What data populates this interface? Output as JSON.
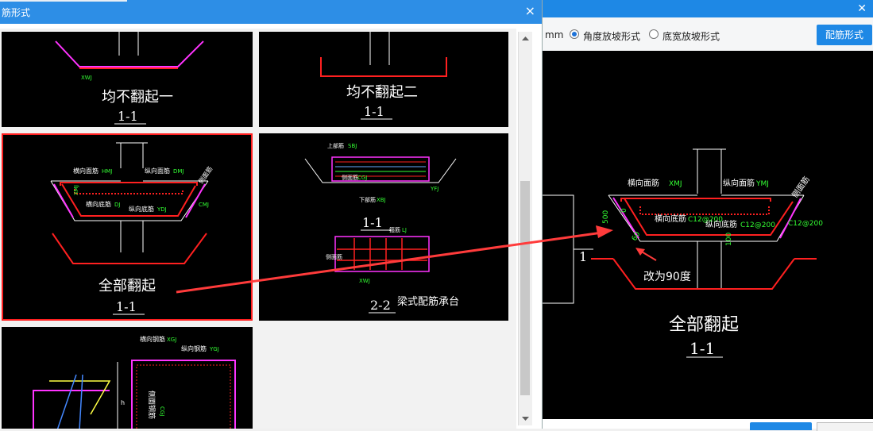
{
  "dialog": {
    "title": "筋形式",
    "close_icon": "×"
  },
  "thumbnails": [
    {
      "caption": "均不翻起一",
      "section": "1-1",
      "tag": "XWJ"
    },
    {
      "caption": "均不翻起二",
      "section": "1-1"
    },
    {
      "caption": "全部翻起",
      "section": "1-1",
      "selected": true,
      "labels": {
        "transverse_top": "横向面筋",
        "transverse_top_code": "HMJ",
        "longitudinal_top": "纵向面筋",
        "longitudinal_top_code": "DMJ",
        "transverse_bottom": "横向底筋",
        "transverse_bottom_code": "DJ",
        "longitudinal_bottom": "纵向底筋",
        "longitudinal_bottom_code": "YDJ",
        "side": "侧面筋",
        "side_code": "CMJ",
        "side_left": "XMJ"
      }
    },
    {
      "caption": "梁式配筋承台",
      "section_top": "1-1",
      "section_bottom": "2-2",
      "labels": {
        "top_bar": "上部筋",
        "top_bar_code": "SBJ",
        "side_bar": "侧面筋",
        "side_code": "CGJ",
        "bottom_bar": "下部筋",
        "bottom_code": "XBJ",
        "stirrup": "箍筋",
        "stirrup_code": "LJ",
        "side_left": "侧面筋",
        "xwj": "XWJ",
        "yfj": "YFJ"
      }
    },
    {
      "labels": {
        "transverse": "横向钢筋",
        "transverse_code": "XGJ",
        "longitudinal": "纵向钢筋",
        "longitudinal_code": "YGJ",
        "side": "侧面钢筋",
        "side_code": "CGJ",
        "dim": "h"
      }
    }
  ],
  "right_panel": {
    "unit": "mm",
    "radio_angle": "角度放坡形式",
    "radio_width": "底宽放坡形式",
    "button": "配筋形式",
    "diagram": {
      "transverse_top": "横向面筋",
      "transverse_top_code": "XMJ",
      "longitudinal_top": "纵向面筋",
      "longitudinal_top_code": "YMJ",
      "transverse_bottom": "横向底筋",
      "transverse_bottom_value": "C12@200",
      "longitudinal_bottom": "纵向底筋",
      "longitudinal_bottom_value": "C12@200",
      "side_value": "C12@200",
      "side_label": "侧面筋",
      "dim_500": "500",
      "dim_0": "0",
      "dim_60": "60",
      "dim_100": "100",
      "annotation": "改为90度",
      "caption": "全部翻起",
      "section": "1-1",
      "partial_label": "1"
    }
  },
  "colors": {
    "accent": "#2d8ee6",
    "selected_border": "#ff2020",
    "arrow": "#ff3b3b",
    "rebar_red": "#ff2020",
    "rebar_green": "#33ff33",
    "rebar_magenta": "#ff33ff"
  }
}
